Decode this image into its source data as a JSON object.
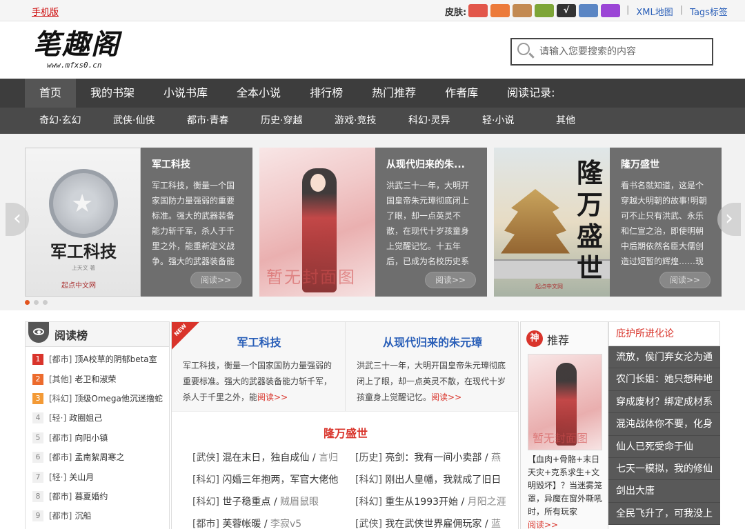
{
  "topbar": {
    "mobile_label": "手机版",
    "skin_label": "皮肤:",
    "skins": [
      {
        "color": "#e2564a",
        "check": ""
      },
      {
        "color": "#ec7a3a",
        "check": ""
      },
      {
        "color": "#c38a52",
        "check": ""
      },
      {
        "color": "#7da537",
        "check": ""
      },
      {
        "color": "#333333",
        "check": "√"
      },
      {
        "color": "#5b86c4",
        "check": ""
      },
      {
        "color": "#9b45d6",
        "check": ""
      }
    ],
    "links": [
      "XML地图",
      "Tags标签"
    ]
  },
  "header": {
    "logo_text": "笔趣阁",
    "logo_url_text": "www.mfxs0.cn",
    "search_placeholder": "请输入您要搜索的内容"
  },
  "nav_main": [
    "首页",
    "我的书架",
    "小说书库",
    "全本小说",
    "排行榜",
    "热门推荐",
    "作者库",
    "阅读记录:"
  ],
  "nav_sub": [
    "奇幻·玄幻",
    "武侠·仙侠",
    "都市·青春",
    "历史·穿越",
    "游戏·竞技",
    "科幻·灵异",
    "轻·小说",
    "其他"
  ],
  "slider": {
    "read_label": "阅读>>",
    "slides": [
      {
        "title": "军工科技",
        "desc": "军工科技，衡量一个国家国防力量强弱的重要标准。强大的武器装备能力斩千军，杀人于千里之外，能重新定义战争。强大的武器装备能",
        "cover_title": "军工科技",
        "cover_author": "上天文 著",
        "cover_pub": "起点中文网"
      },
      {
        "title": "从现代归来的朱...",
        "desc": "洪武三十一年，大明开国皇帝朱元璋彻底闭上了眼，却一点英灵不散，在现代十岁孩童身上觉醒记忆。十五年后，已成为名校历史系",
        "cover_watermark": "暂无封面图"
      },
      {
        "title": "隆万盛世",
        "desc": "看书名就知道，这是个穿越大明朝的故事!明朝可不止只有洪武、永乐和仁宣之治，即使明朝中后期依然名臣大儒创造过短暂的辉煌……现",
        "cover_title": "隆万盛世",
        "cover_pub": "起点中文网"
      }
    ],
    "dots": 3,
    "prev_icon": "‹",
    "next_icon": "›"
  },
  "rank": {
    "title": "阅读榜",
    "items": [
      {
        "num": "1",
        "cat": "[都市]",
        "name": "顶A校草的阴郁beta室"
      },
      {
        "num": "2",
        "cat": "[其他]",
        "name": "老卫和淑荣"
      },
      {
        "num": "3",
        "cat": "[科幻]",
        "name": "顶级Omega他沉迷撸蛇"
      },
      {
        "num": "4",
        "cat": "[轻·]",
        "name": "政圈姐己"
      },
      {
        "num": "5",
        "cat": "[都市]",
        "name": "向阳小镇"
      },
      {
        "num": "6",
        "cat": "[都市]",
        "name": "孟南絮周寒之"
      },
      {
        "num": "7",
        "cat": "[轻·]",
        "name": "关山月"
      },
      {
        "num": "8",
        "cat": "[都市]",
        "name": "暮夏婚约"
      },
      {
        "num": "9",
        "cat": "[都市]",
        "name": "沉船"
      }
    ]
  },
  "featured": {
    "new_label": "NEW",
    "more_label": "阅读>>",
    "top": [
      {
        "title": "军工科技",
        "desc": "军工科技，衡量一个国家国防力量强弱的重要标准。强大的武器装备能力斩千军，杀人于千里之外，能"
      },
      {
        "title": "从现代归来的朱元璋",
        "desc": "洪武三十一年，大明开国皇帝朱元璋彻底闭上了眼，却一点英灵不散，在现代十岁孩童身上觉醒记忆。"
      }
    ],
    "main_title": "隆万盛世",
    "books": [
      {
        "cat": "[武侠]",
        "name": "混在末日，独自成仙",
        "author": "言归"
      },
      {
        "cat": "[历史]",
        "name": "亮剑：我有一间小卖部",
        "author": "燕"
      },
      {
        "cat": "[科幻]",
        "name": "闪婚三年抱两，军官大佬他",
        "author": ""
      },
      {
        "cat": "[科幻]",
        "name": "刚出人皇幡，我就成了旧日",
        "author": ""
      },
      {
        "cat": "[科幻]",
        "name": "世子稳重点",
        "author": "贼眉鼠眼"
      },
      {
        "cat": "[科幻]",
        "name": "重生从1993开始",
        "author": "月阳之涯"
      },
      {
        "cat": "[都市]",
        "name": "芙蓉帐暖",
        "author": "李寂v5"
      },
      {
        "cat": "[武侠]",
        "name": "我在武侠世界雇佣玩家",
        "author": "蓝"
      }
    ]
  },
  "recommend": {
    "badge": "神",
    "title": "推荐",
    "cover_watermark": "暂无封面图",
    "desc": "【血肉+骨骼+末日天灾+克系求生+文明毁坏】？当迷雾笼罩，异魔在窗外嘶吼时，所有玩家",
    "more_label": "阅读>>"
  },
  "side": {
    "head": "庇护所进化论",
    "items": [
      "流放，侯门弃女沦为通",
      "农门长姐：她只想种地",
      "穿成废材？绑定成材系",
      "混沌战体你不要，化身",
      "仙人已死受命于仙",
      "七天一模拟，我的修仙",
      "剑出大唐",
      "全民飞升了，可我没上"
    ]
  }
}
